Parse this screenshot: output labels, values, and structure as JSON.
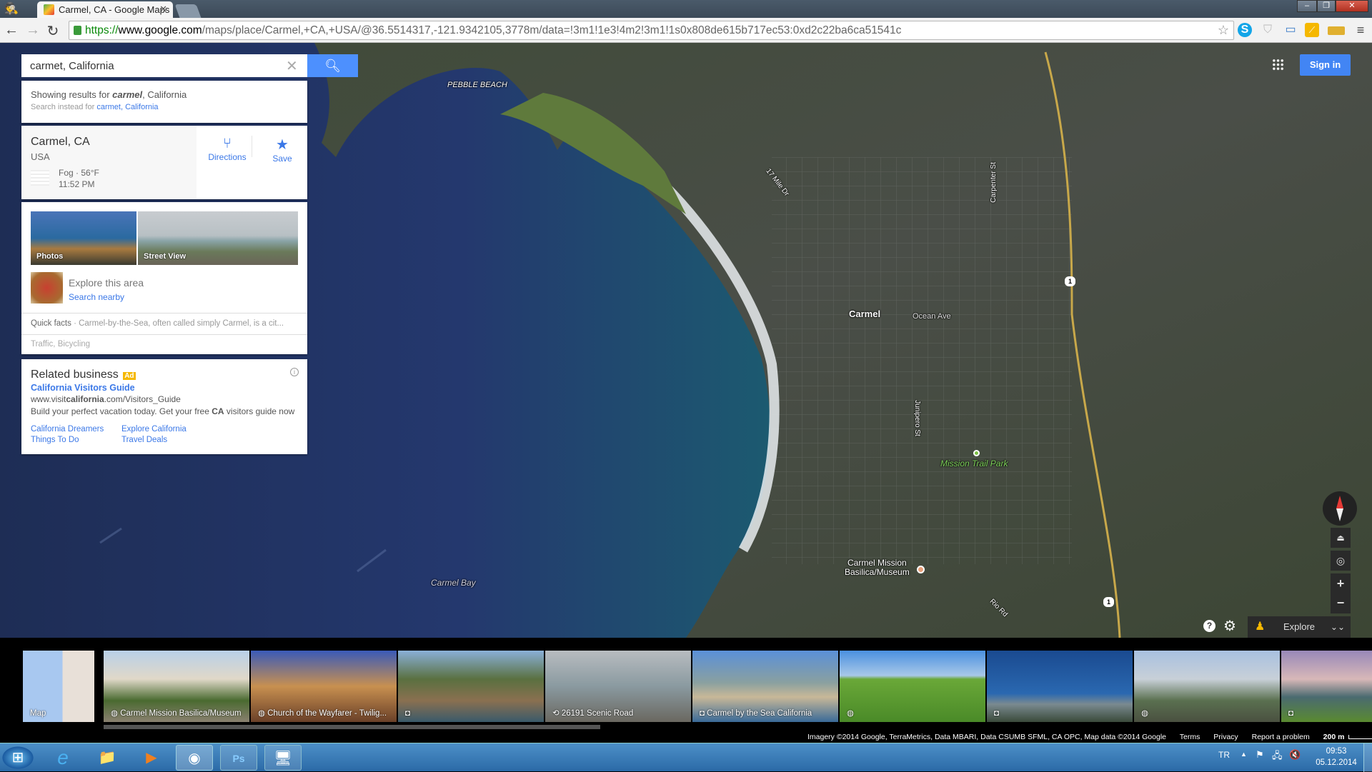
{
  "browser": {
    "tab_title": "Carmel, CA - Google Maps",
    "url_scheme": "https://",
    "url_host": "www.google.com",
    "url_path": "/maps/place/Carmel,+CA,+USA/@36.5514317,-121.9342105,3778m/data=!3m1!1e3!4m2!3m1!1s0x808de615b717ec53:0xd2c22ba6ca51541c",
    "extensions": [
      "skype-icon",
      "shield-icon",
      "screenshot-icon",
      "chart-icon",
      "ruler-icon"
    ]
  },
  "search": {
    "value": "carmet, California"
  },
  "correction": {
    "prefix": "Showing results for ",
    "bold": "carmel",
    "suffix": ", California",
    "instead_prefix": "Search instead for ",
    "instead_link": "carmet, California"
  },
  "place": {
    "name": "Carmel, CA",
    "country": "USA",
    "weather": "Fog · 56°F",
    "time": "11:52 PM",
    "directions": "Directions",
    "save": "Save"
  },
  "media": {
    "photos": "Photos",
    "street_view": "Street View",
    "explore_title": "Explore this area",
    "search_nearby": "Search nearby",
    "quick_facts_label": "Quick facts",
    "quick_facts_text": " · Carmel-by-the-Sea, often called simply Carmel, is a cit...",
    "layers": "Traffic, Bicycling"
  },
  "ad": {
    "heading": "Related business",
    "badge": "Ad",
    "title": "California Visitors Guide",
    "url_pre": "www.visit",
    "url_bold": "california",
    "url_post": ".com/Visitors_Guide",
    "desc_pre": "Build your perfect vacation today. Get your free ",
    "desc_bold": "CA",
    "desc_post": " visitors guide now",
    "links": [
      "California Dreamers",
      "Explore California",
      "Things To Do",
      "Travel Deals"
    ]
  },
  "header": {
    "sign_in": "Sign in"
  },
  "map_labels": {
    "pebble_beach": "PEBBLE BEACH",
    "mile_dr": "17 Mile Dr",
    "carpenter": "Carpenter St",
    "carmel": "Carmel",
    "ocean_ave": "Ocean Ave",
    "junipero": "Junipero St",
    "mission_trail": "Mission Trail Park",
    "mission": "Carmel Mission\nBasilica/Museum",
    "rio_rd": "Rio Rd",
    "carmel_bay": "Carmel Bay",
    "route": "1"
  },
  "controls": {
    "explore": "Explore"
  },
  "thumbnails": [
    {
      "label": "Map"
    },
    {
      "label": "Carmel Mission Basilica/Museum",
      "icon": "360-icon"
    },
    {
      "label": "Church of the Wayfarer - Twilig...",
      "icon": "360-icon"
    },
    {
      "label": "",
      "icon": "camera-icon"
    },
    {
      "label": "26191 Scenic Road",
      "icon": "streetview-icon"
    },
    {
      "label": "Carmel by the Sea California",
      "icon": "camera-icon"
    },
    {
      "label": "",
      "icon": "360-icon"
    },
    {
      "label": "",
      "icon": "camera-icon"
    },
    {
      "label": "",
      "icon": "360-icon"
    },
    {
      "label": "",
      "icon": "camera-icon"
    }
  ],
  "footer": {
    "attribution": "Imagery ©2014 Google, TerraMetrics, Data MBARI, Data CSUMB SFML, CA OPC, Map data ©2014 Google",
    "terms": "Terms",
    "privacy": "Privacy",
    "report": "Report a problem",
    "scale": "200 m"
  },
  "taskbar": {
    "lang": "TR",
    "time": "09:53",
    "date": "05.12.2014"
  }
}
